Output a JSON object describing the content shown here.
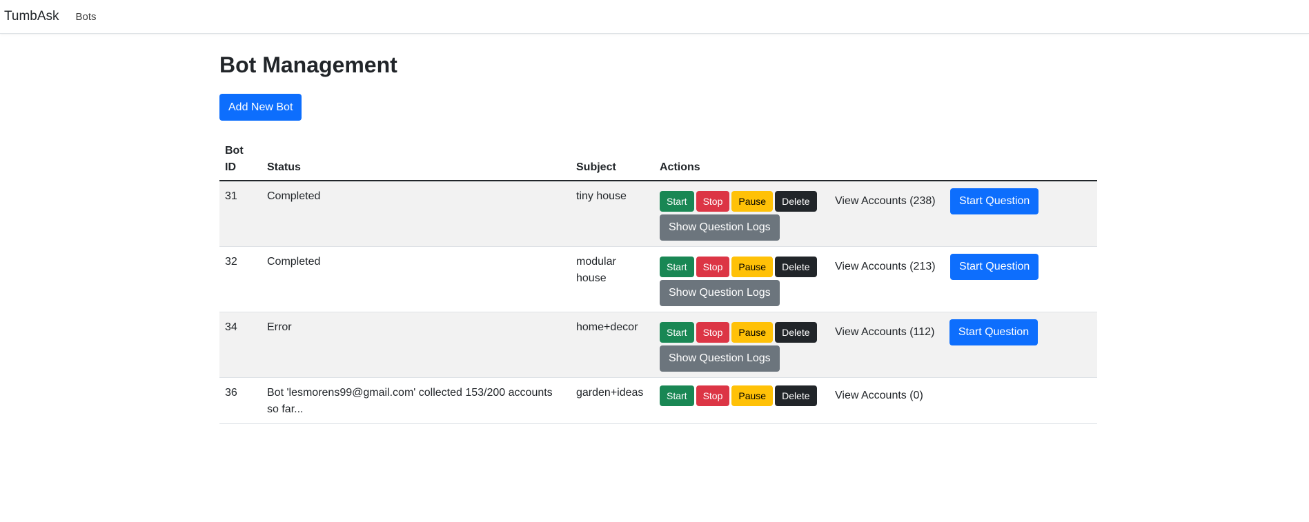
{
  "navbar": {
    "brand": "TumbAsk",
    "links": [
      "Bots"
    ]
  },
  "page": {
    "title": "Bot Management",
    "add_button": "Add New Bot"
  },
  "table": {
    "headers": {
      "bot_id": "Bot ID",
      "status": "Status",
      "subject": "Subject",
      "actions": "Actions"
    },
    "action_labels": {
      "start": "Start",
      "stop": "Stop",
      "pause": "Pause",
      "delete": "Delete",
      "start_question": "Start Question",
      "show_logs": "Show Question Logs"
    },
    "rows": [
      {
        "id": "31",
        "status": "Completed",
        "subject": "tiny house",
        "view_accounts": "View Accounts (238)"
      },
      {
        "id": "32",
        "status": "Completed",
        "subject": "modular house",
        "view_accounts": "View Accounts (213)"
      },
      {
        "id": "34",
        "status": "Error",
        "subject": "home+decor",
        "view_accounts": "View Accounts (112)"
      },
      {
        "id": "36",
        "status": "Bot 'lesmorens99@gmail.com' collected 153/200 accounts so far...",
        "subject": "garden+ideas",
        "view_accounts": "View Accounts (0)"
      }
    ]
  }
}
